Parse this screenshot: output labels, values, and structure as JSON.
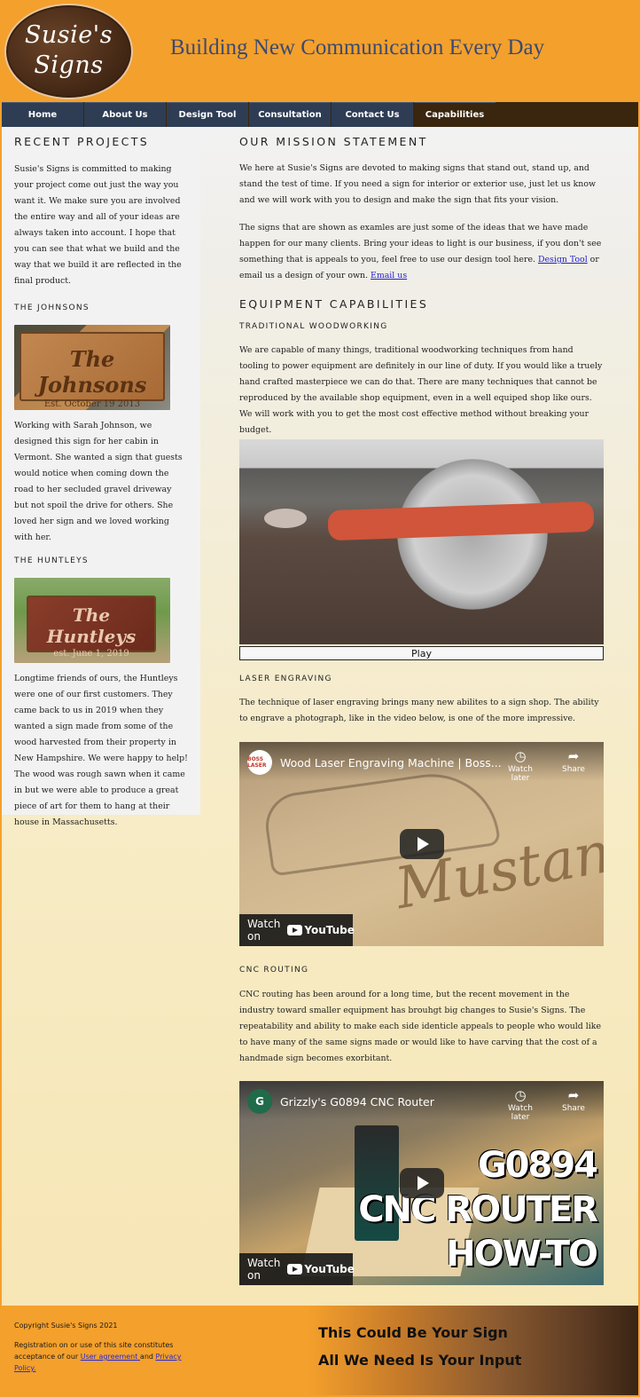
{
  "header": {
    "logo_line1": "Susie's",
    "logo_line2": "Signs",
    "tagline": "Building New Communication Every Day"
  },
  "nav": {
    "items": [
      "Home",
      "About Us",
      "Design Tool",
      "Consultation",
      "Contact Us",
      "Capabilities"
    ],
    "active": "Capabilities"
  },
  "sidebar": {
    "title": "RECENT PROJECTS",
    "intro": "Susie's Signs is committed to making your project come out just the way you want it. We make sure you are involved the entire way and all of your ideas are always taken into account. I hope that you can see that what we build and the way that we build it are reflected in the final product.",
    "projects": [
      {
        "heading": "THE JOHNSONS",
        "sign_main": "The Johnsons",
        "sign_sub": "Est. October 19 2013",
        "text": "Working with Sarah Johnson, we designed this sign for her cabin in Vermont. She wanted a sign that guests would notice when coming down the road to her secluded gravel driveway but not spoil the drive for others. She loved her sign and we loved working with her."
      },
      {
        "heading": "THE HUNTLEYS",
        "sign_main": "The Huntleys",
        "sign_sub": "est. June 1, 2019",
        "text": "Longtime friends of ours, the Huntleys were one of our first customers. They came back to us in 2019 when they wanted a sign made from some of the wood harvested from their property in New Hampshire. We were happy to help! The wood was rough sawn when it came in but we were able to produce a great piece of art for them to hang at their house in Massachusetts."
      }
    ]
  },
  "main": {
    "mission_title": "OUR MISSION STATEMENT",
    "mission_p1": "We here at Susie's Signs are devoted to making signs that stand out, stand up, and stand the test of time. If you need a sign for interior or exterior use, just let us know and we will work with you to design and make the sign that fits your vision.",
    "mission_p2_before": "The signs that are shown as examles are just some of the ideas that we have made happen for our many clients. Bring your ideas to light is our business, if you don't see something that is appeals to you, feel free to use our design tool here. ",
    "mission_p2_link1": "Design Tool",
    "mission_p2_mid": " or email us a design of your own. ",
    "mission_p2_link2": "Email us",
    "equipment_title": "EQUIPMENT CAPABILITIES",
    "woodworking_heading": "TRADITIONAL WOODWORKING",
    "woodworking_text": "We are capable of many things, traditional woodworking techniques from hand tooling to power equipment are definitely in our line of duty. If you would like a truely hand crafted masterpiece we can do that. There are many techniques that cannot be reproduced by the available shop equipment, even in a well equiped shop like ours. We will work with you to get the most cost effective method without breaking your budget.",
    "play_label": "Play",
    "laser_heading": "LASER ENGRAVING",
    "laser_text": "The technique of laser engraving brings many new abilites to a sign shop. The ability to engrave a photograph, like in the video below, is one of the more impressive.",
    "laser_video": {
      "title": "Wood Laser Engraving Machine | Boss...",
      "avatar": "BOSS LASER",
      "watch_later": "Watch later",
      "share": "Share",
      "watch_on": "Watch on",
      "yt_brand": "YouTube",
      "overlay_text": "Mustang"
    },
    "cnc_heading": "CNC ROUTING",
    "cnc_text": "CNC routing has been around for a long time, but the recent movement in the industry toward smaller equipment has brouhgt big changes to Susie's Signs. The repeatability and ability to make each side identicle appeals to people who would like to have many of the same signs made or would like to have carving that the cost of a handmade sign becomes exorbitant.",
    "cnc_video": {
      "title": "Grizzly's G0894 CNC Router",
      "avatar": "G",
      "watch_later": "Watch later",
      "share": "Share",
      "watch_on": "Watch on",
      "yt_brand": "YouTube",
      "overlay_line1": "G0894",
      "overlay_line2": "CNC ROUTER",
      "overlay_line3": "HOW-TO"
    }
  },
  "footer": {
    "copyright": "Copyright Susie's Signs 2021",
    "reg_before": "Registration on or use of this site constitutes acceptance of our ",
    "reg_link1": "User agreement ",
    "reg_mid": "and ",
    "reg_link2": "Privacy Policy.",
    "slogan1": "This Could Be Your Sign",
    "slogan2": "All We Need Is Your Input"
  },
  "colors": {
    "header_bg": "#f4a02c",
    "nav_bg": "#2e3d54",
    "nav_active": "#3a260e",
    "tagline": "#3b4a70",
    "link": "#2222cc"
  }
}
